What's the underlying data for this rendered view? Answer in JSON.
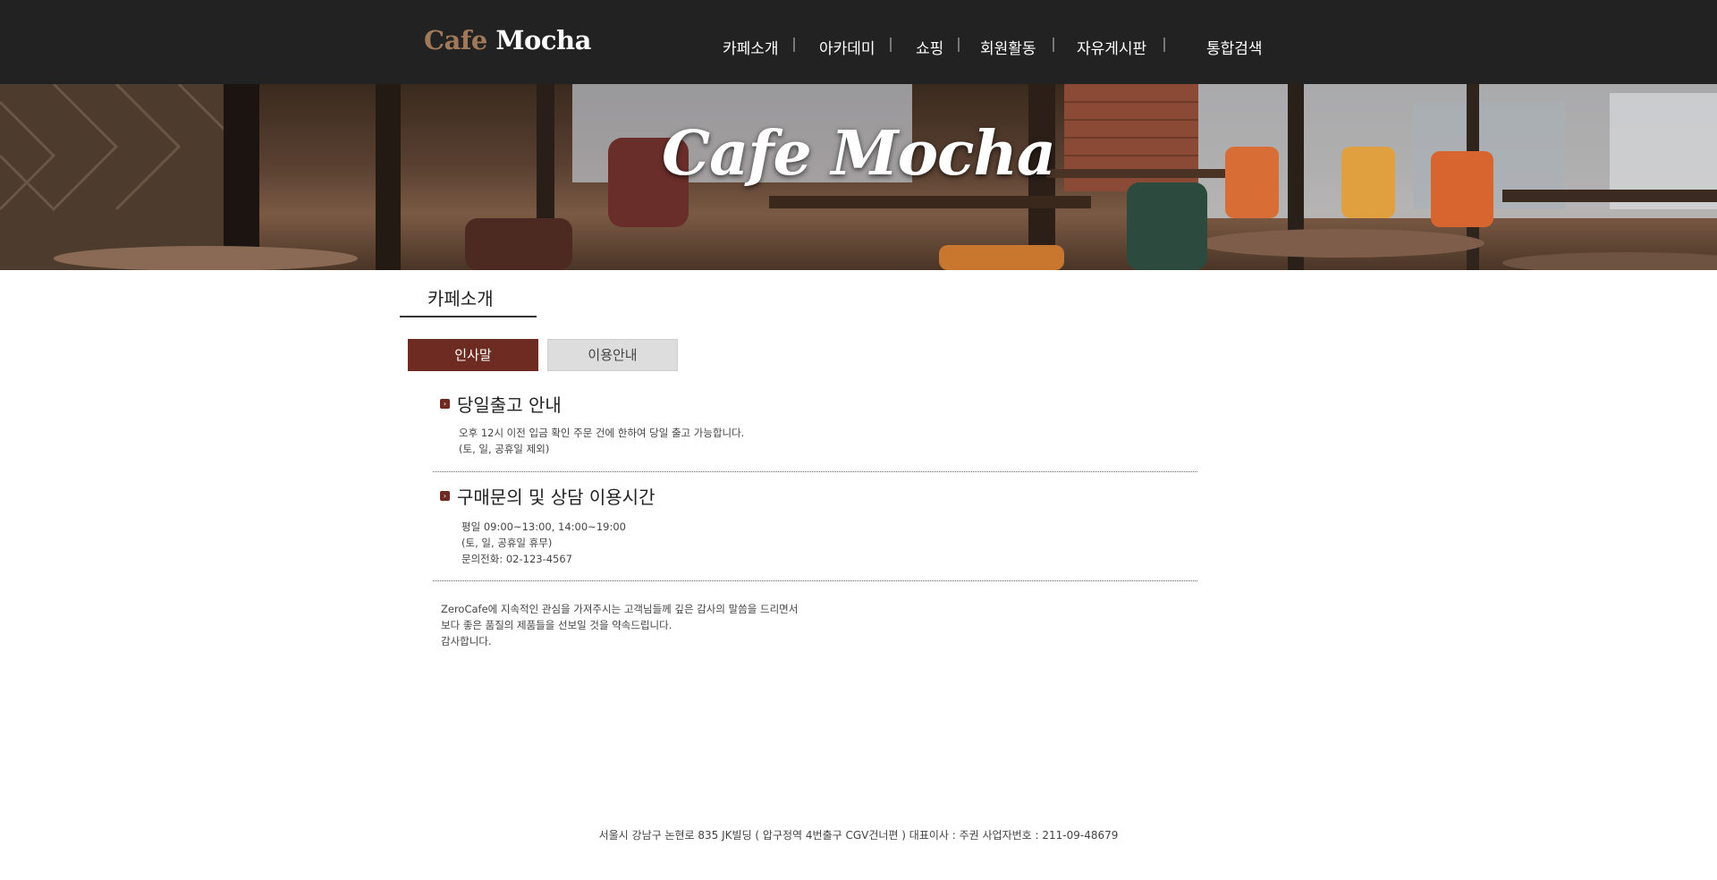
{
  "header": {
    "logo_part1": "Cafe",
    "logo_part2": "Mocha",
    "nav": [
      {
        "label": "카페소개"
      },
      {
        "label": "아카데미"
      },
      {
        "label": "쇼핑"
      },
      {
        "label": "회원활동"
      },
      {
        "label": "자유게시판"
      },
      {
        "label": "통합검색"
      }
    ]
  },
  "banner": {
    "title": "Cafe Mocha"
  },
  "section": {
    "title": "카페소개",
    "tabs": [
      {
        "label": "인사말",
        "active": true
      },
      {
        "label": "이용안내",
        "active": false
      }
    ]
  },
  "blocks": [
    {
      "heading": "당일출고 안내",
      "lines": [
        "오후 12시 이전 입금 확인 주문 건에 한하여 당일 출고 가능합니다.",
        "(토, 일, 공휴일 제외)"
      ]
    },
    {
      "heading": "구매문의 및 상담 이용시간",
      "lines": [
        "평일 09:00~13:00, 14:00~19:00",
        "(토, 일, 공휴일 휴무)",
        "문의전화: 02-123-4567"
      ]
    }
  ],
  "closing": {
    "lines": [
      "ZeroCafe에 지속적인 관심을 가져주시는 고객님들께 깊은 감사의 말씀을 드리면서",
      "보다 좋은 품질의 제품들을 선보일 것을 약속드립니다.",
      "감사합니다."
    ]
  },
  "footer": {
    "text": "서울시 강남구 논현로 835 JK빌딩 ( 압구정역 4번출구 CGV건너편 )  대표이사 : 주권  사업자번호 : 211-09-48679"
  },
  "colors": {
    "header_bg": "#222222",
    "accent": "#6e2b22",
    "logo_cafe": "#a0785a",
    "tab_inactive": "#dddddd"
  },
  "icons": {
    "bullet": "chevron-right-square-icon"
  }
}
